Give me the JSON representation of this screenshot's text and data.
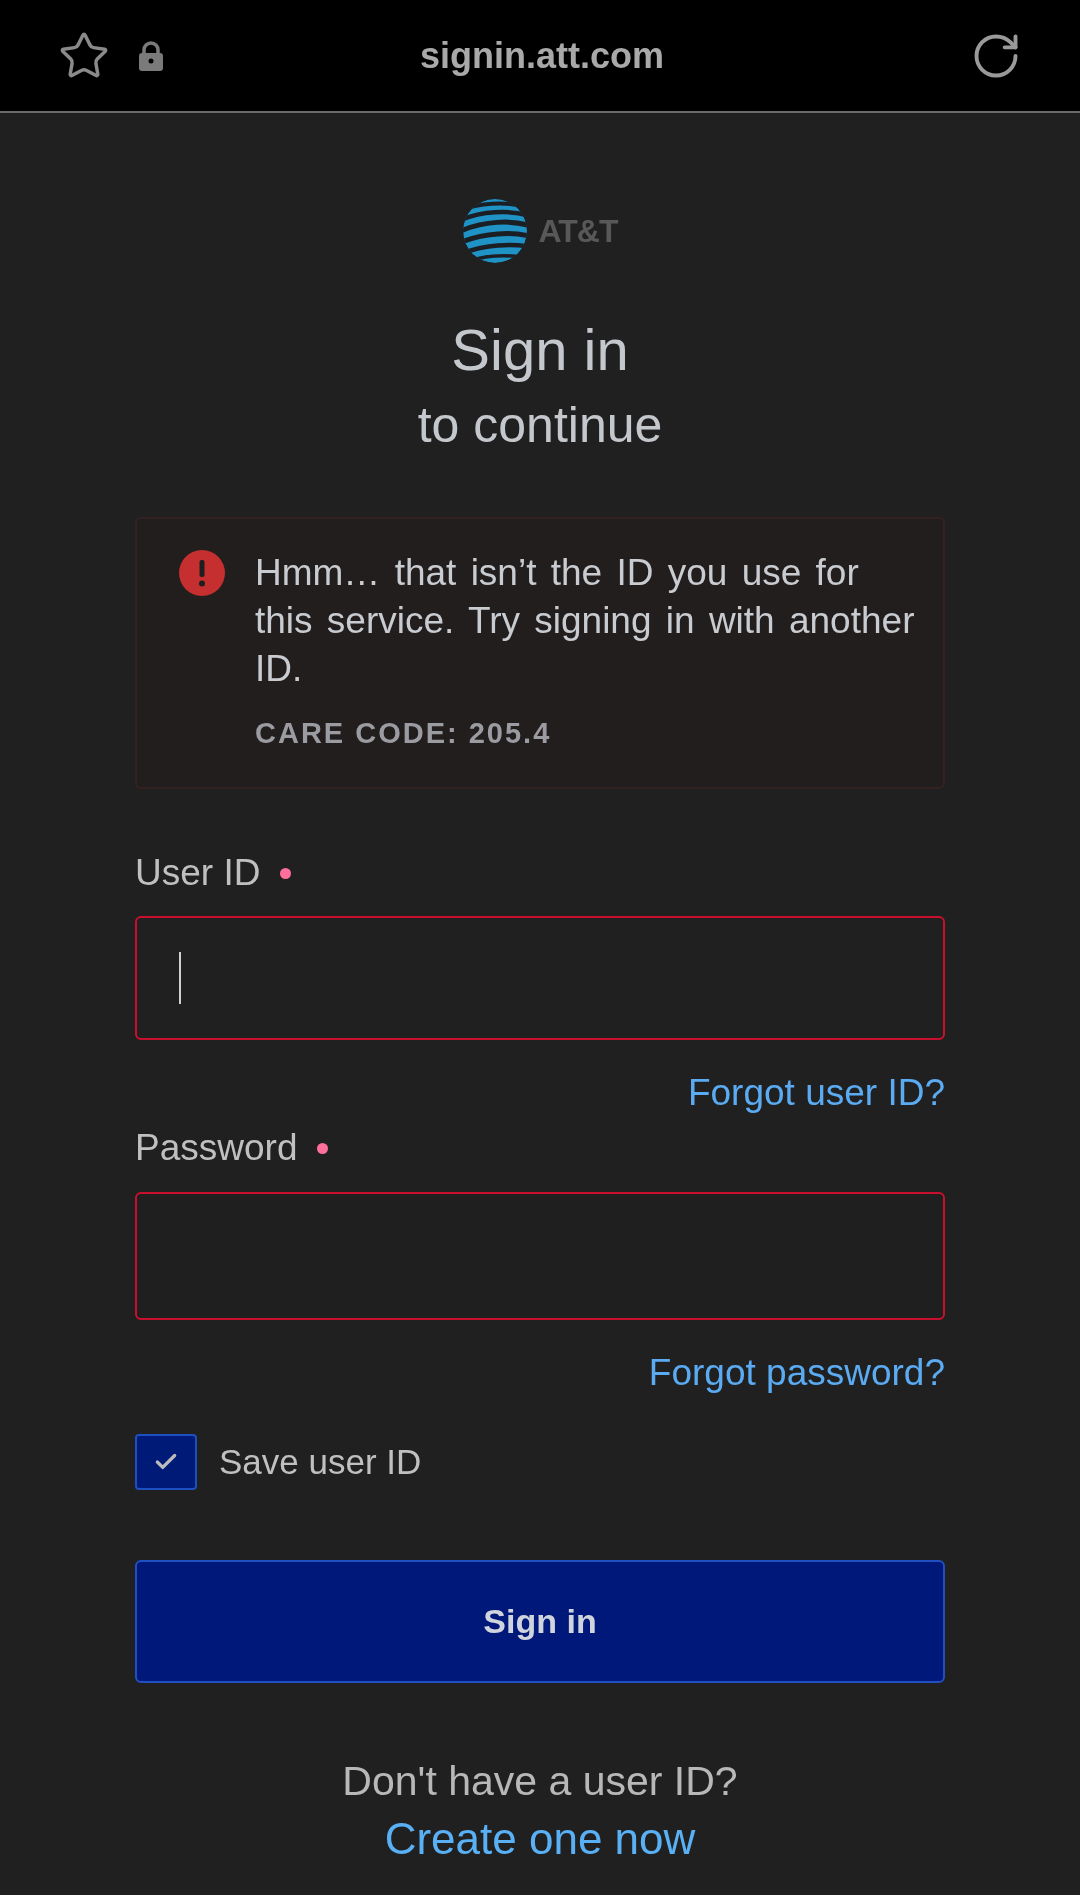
{
  "browser_bar": {
    "url": "signin.att.com"
  },
  "logo": {
    "wordmark": "AT&T"
  },
  "heading": {
    "title": "Sign in",
    "subtitle": "to continue"
  },
  "error": {
    "message": "Hmm… that isn’t the ID you use for this service. Try signing in with another ID.",
    "care_code": "CARE CODE: 205.4"
  },
  "fields": [
    {
      "label": "User ID",
      "required": true,
      "invalid": true,
      "focused": true,
      "link": "Forgot user ID?"
    },
    {
      "label": "Password",
      "required": true,
      "invalid": true,
      "focused": false,
      "link": "Forgot password?"
    }
  ],
  "save_user_id": {
    "label": "Save user ID",
    "checked": true
  },
  "submit": {
    "label": "Sign in"
  },
  "signup": {
    "prompt": "Don't have a user ID?",
    "link": "Create one now"
  }
}
